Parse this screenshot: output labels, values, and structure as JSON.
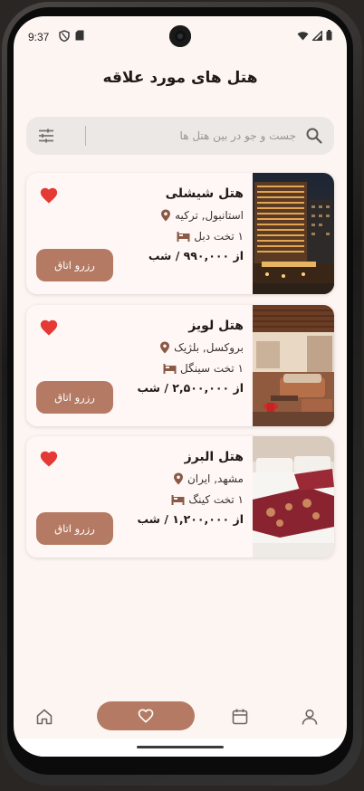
{
  "status_bar": {
    "time": "9:37",
    "left_icons": [
      "shield-icon",
      "sd-card-icon"
    ],
    "right_icons": [
      "wifi-icon",
      "signal-icon",
      "battery-icon"
    ]
  },
  "header": {
    "title": "هتل های مورد علاقه"
  },
  "search": {
    "placeholder": "جست و جو در بین هتل ها",
    "value": "",
    "icon": "search-icon",
    "filter_icon": "filter-sliders-icon"
  },
  "hotels": [
    {
      "name": "هتل شیشلی",
      "location": "استانبول, ترکیه",
      "bed": "۱ تخت دبل",
      "price": "از ۹۹۰,۰۰۰ / شب",
      "book_label": "رزرو اتاق",
      "favorite": true,
      "image": "hotel-building-night-photo"
    },
    {
      "name": "هتل لویز",
      "location": "بروکسل, بلژیک",
      "bed": "۱ تخت سینگل",
      "price": "از ۲,۵۰۰,۰۰۰ / شب",
      "book_label": "رزرو اتاق",
      "favorite": true,
      "image": "hotel-lounge-room-photo"
    },
    {
      "name": "هتل البرز",
      "location": "مشهد, ایران",
      "bed": "۱ تخت کینگ",
      "price": "از ۱,۲۰۰,۰۰۰ / شب",
      "book_label": "رزرو اتاق",
      "favorite": true,
      "image": "hotel-bedroom-photo"
    }
  ],
  "bottom_nav": {
    "items": [
      {
        "icon": "home-icon",
        "active": false
      },
      {
        "icon": "heart-icon",
        "active": true
      },
      {
        "icon": "calendar-icon",
        "active": false
      },
      {
        "icon": "profile-icon",
        "active": false
      }
    ]
  },
  "colors": {
    "accent": "#b57a63",
    "background": "#fdf5f2",
    "heart": "#e53935",
    "location_icon": "#8a5a47"
  }
}
